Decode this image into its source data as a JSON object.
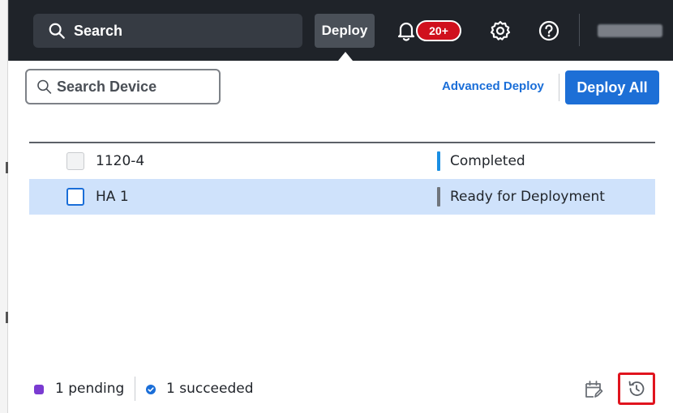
{
  "topbar": {
    "search_label": "Search",
    "deploy_label": "Deploy",
    "notification_count": "20+",
    "icons": {
      "search": "magnifier-icon",
      "bell": "bell-icon",
      "settings": "gear-icon",
      "help": "question-circle-icon"
    }
  },
  "panel": {
    "search_placeholder": "Search Device",
    "advanced_deploy_label": "Advanced Deploy",
    "deploy_all_label": "Deploy All",
    "devices": [
      {
        "name": "1120-4",
        "status": "Completed",
        "status_color": "#1a8fe3",
        "selected": false
      },
      {
        "name": "HA 1",
        "status": "Ready for Deployment",
        "status_color": "#70757c",
        "selected": true
      }
    ]
  },
  "footer": {
    "pending_text": "1 pending",
    "succeeded_text": "1 succeeded",
    "pending_color": "#7a3bd1",
    "succeeded_color": "#1a6ed8"
  },
  "colors": {
    "topbar_bg": "#1f2329",
    "accent": "#1d6fd6",
    "selected_row": "#cfe2fb",
    "badge": "#d0101d",
    "highlight_box": "#e0141e"
  }
}
